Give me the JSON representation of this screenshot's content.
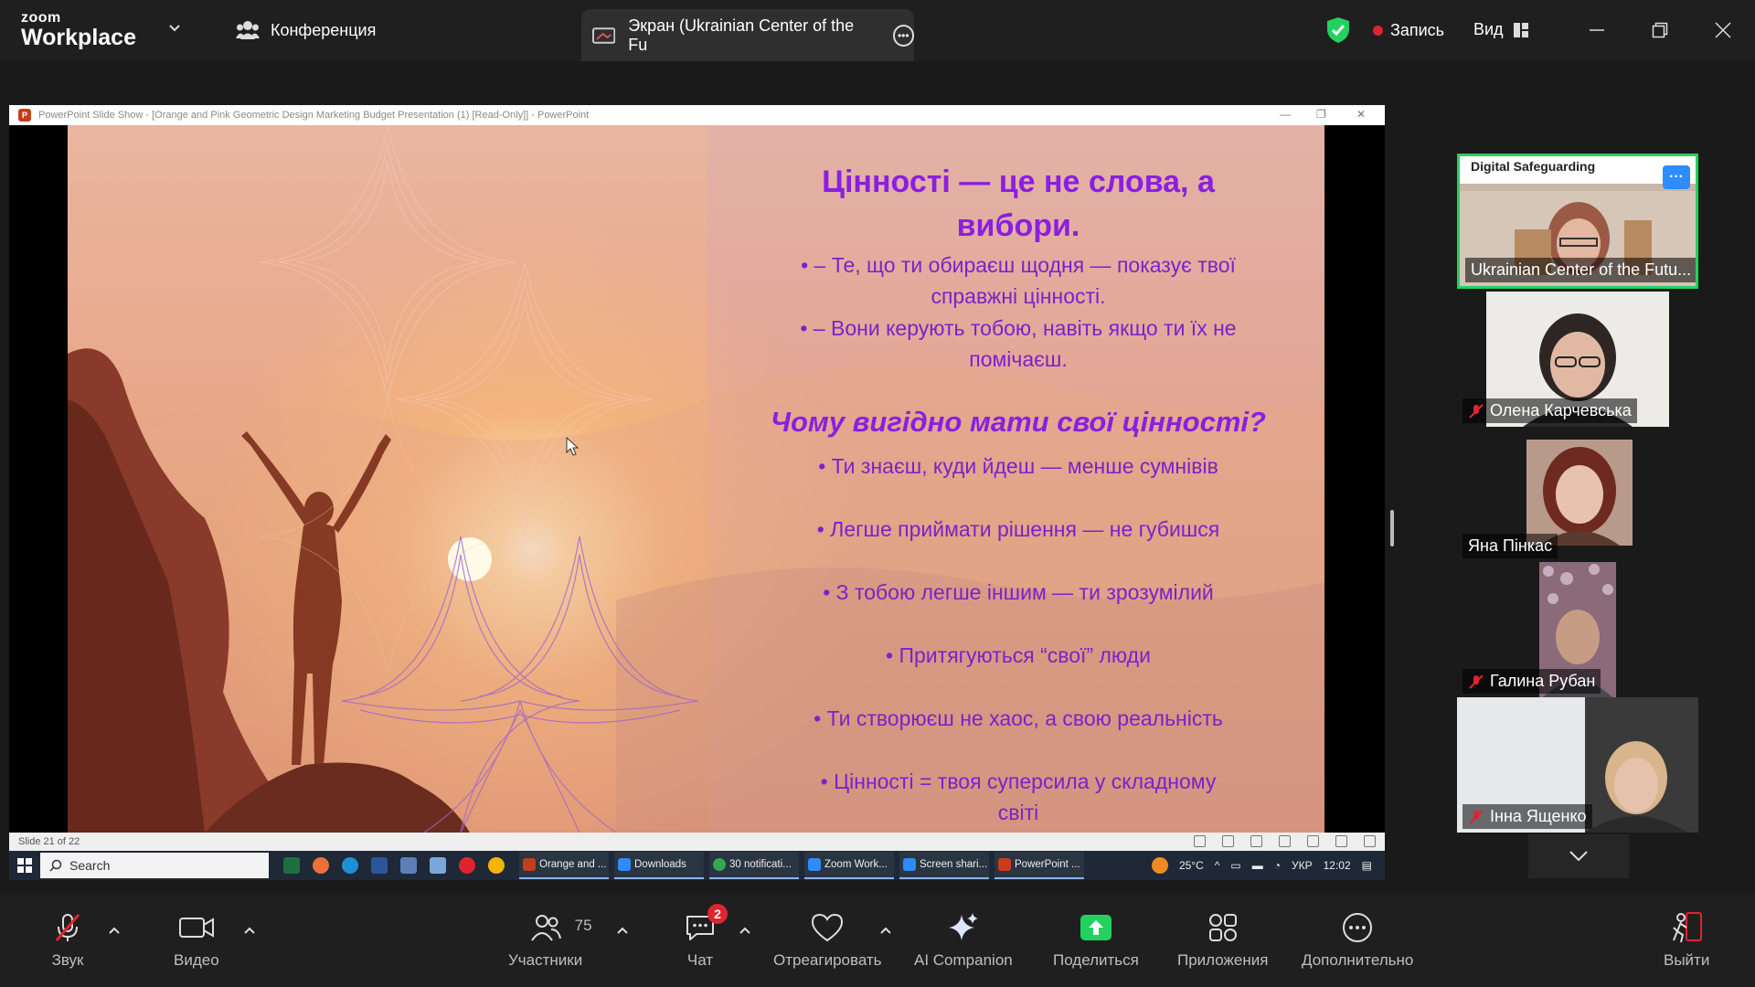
{
  "topbar": {
    "brand_small": "zoom",
    "brand_large": "Workplace",
    "meeting_label": "Конференция",
    "share_tab_label": "Экран (Ukrainian Center of the Fu",
    "record_label": "Запись",
    "view_label": "Вид"
  },
  "ppt": {
    "window_title": "PowerPoint Slide Show - [Orange and Pink Geometric Design Marketing Budget Presentation (1) [Read-Only]] - PowerPoint",
    "status": "Slide 21 of 22",
    "slide": {
      "title_line1": "Цінності — це не слова, а",
      "title_line2": "вибори.",
      "bullet1_line1": "• – Те, що ти обираєш щодня — показує твої",
      "bullet1_line2": "справжні цінності.",
      "bullet2_line1": "• – Вони керують тобою, навіть якщо ти їх не",
      "bullet2_line2": "помічаєш.",
      "subtitle": "Чому  вигідно мати свої цінності?",
      "items": [
        "•  Ти знаєш, куди йдеш — менше сумнівів",
        "•  Легше приймати рішення — не губишся",
        "•  З тобою легше іншим — ти зрозумілий",
        "•  Притягуються “свої” люди",
        "•  Ти створюєш не хаос, а свою реальність",
        "•  Цінності = твоя суперсила у складному",
        "світі"
      ]
    }
  },
  "taskbar": {
    "search": "Search",
    "apps": [
      {
        "label": "Orange and ...",
        "color": "#c43e1c"
      },
      {
        "label": "Downloads",
        "color": "#2d8cff"
      },
      {
        "label": "30 notificati...",
        "color": "#34a853"
      },
      {
        "label": "Zoom Work...",
        "color": "#2d8cff"
      },
      {
        "label": "Screen shari...",
        "color": "#2d8cff"
      },
      {
        "label": "PowerPoint ...",
        "color": "#c43e1c"
      }
    ],
    "temperature": "25°C",
    "language": "УКР",
    "time": "12:02"
  },
  "participants": [
    {
      "name": "Ukrainian Center of the Futu...",
      "overlay_title": "Digital Safeguarding",
      "muted": false,
      "active": true
    },
    {
      "name": "Олена Карчевська",
      "muted": true
    },
    {
      "name": "Яна Пінкас",
      "muted": false
    },
    {
      "name": "Галина Рубан",
      "muted": true
    },
    {
      "name": "Інна Ященко",
      "muted": true
    }
  ],
  "toolbar": {
    "audio": "Звук",
    "video": "Видео",
    "participants": "Участники",
    "participants_count": "75",
    "chat": "Чат",
    "chat_badge": "2",
    "react": "Отреагировать",
    "ai": "AI Companion",
    "share": "Поделиться",
    "apps": "Приложения",
    "more": "Дополнительно",
    "leave": "Выйти"
  },
  "colors": {
    "accent_green": "#23d160",
    "share_green": "#23d160",
    "record_red": "#e0242f",
    "slide_purple": "#7a22cc"
  }
}
